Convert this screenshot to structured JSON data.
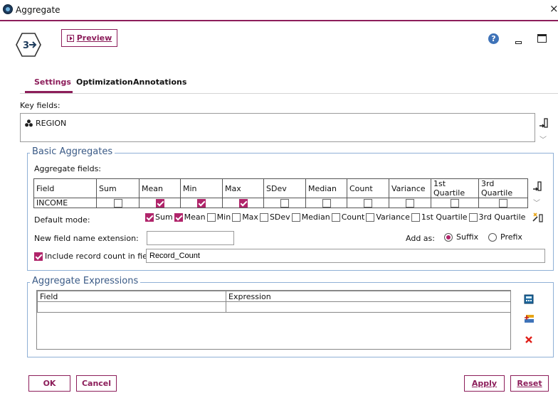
{
  "window": {
    "title": "Aggregate",
    "close_glyph": "×"
  },
  "toolbar": {
    "preview_label": "Preview",
    "help_glyph": "?"
  },
  "tabs": [
    {
      "label": "Settings",
      "active": true
    },
    {
      "label": "Optimization",
      "active": false
    },
    {
      "label": "Annotations",
      "active": false
    }
  ],
  "key_fields": {
    "label": "Key fields:",
    "items": [
      "REGION"
    ]
  },
  "basic_aggregates": {
    "title": "Basic Aggregates",
    "fields_label": "Aggregate fields:",
    "columns": [
      "Field",
      "Sum",
      "Mean",
      "Min",
      "Max",
      "SDev",
      "Median",
      "Count",
      "Variance",
      "1st Quartile",
      "3rd Quartile"
    ],
    "rows": [
      {
        "field": "INCOME",
        "checks": [
          false,
          true,
          true,
          true,
          false,
          false,
          false,
          false,
          false,
          false
        ]
      }
    ],
    "default_mode_label": "Default mode:",
    "default_modes": [
      {
        "label": "Sum",
        "checked": true
      },
      {
        "label": "Mean",
        "checked": true
      },
      {
        "label": "Min",
        "checked": false
      },
      {
        "label": "Max",
        "checked": false
      },
      {
        "label": "SDev",
        "checked": false
      },
      {
        "label": "Median",
        "checked": false
      },
      {
        "label": "Count",
        "checked": false
      },
      {
        "label": "Variance",
        "checked": false
      },
      {
        "label": "1st Quartile",
        "checked": false
      },
      {
        "label": "3rd Quartile",
        "checked": false
      }
    ],
    "extension_label": "New field name extension:",
    "extension_value": "",
    "add_as_label": "Add as:",
    "suffix_label": "Suffix",
    "prefix_label": "Prefix",
    "add_as_selected": "Suffix",
    "include_count_label": "Include record count in field",
    "include_count_checked": true,
    "count_field_value": "Record_Count"
  },
  "aggregate_expressions": {
    "title": "Aggregate Expressions",
    "columns": [
      "Field",
      "Expression"
    ]
  },
  "footer": {
    "ok_label": "OK",
    "cancel_label": "Cancel",
    "apply_label": "Apply",
    "reset_label": "Reset"
  },
  "colors": {
    "accent": "#8c1d5a",
    "check": "#b0246a",
    "group_border": "#8fb0d6",
    "group_title": "#3a5a86",
    "delete_red": "#e0201a"
  }
}
